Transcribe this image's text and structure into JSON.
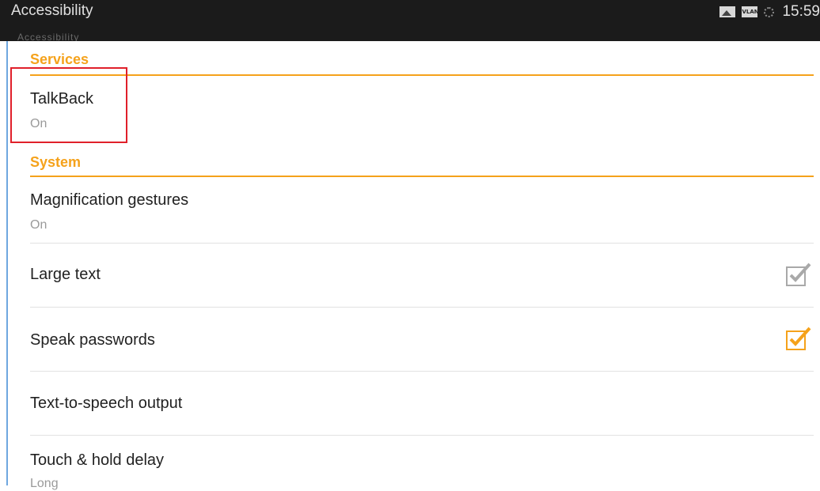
{
  "statusbar": {
    "title": "Accessibility",
    "subtitle": "Accessibility",
    "vlan_label": "VLAN",
    "time": "15:59"
  },
  "sections": {
    "services": {
      "header": "Services",
      "talkback": {
        "title": "TalkBack",
        "summary": "On"
      }
    },
    "system": {
      "header": "System",
      "magnification": {
        "title": "Magnification gestures",
        "summary": "On"
      },
      "large_text": {
        "title": "Large text",
        "checked": true,
        "enabled": false
      },
      "speak_passwords": {
        "title": "Speak passwords",
        "checked": true,
        "enabled": true
      },
      "tts": {
        "title": "Text-to-speech output"
      },
      "touch_hold": {
        "title": "Touch & hold delay",
        "summary": "Long"
      }
    }
  },
  "colors": {
    "accent": "#f5a21b",
    "checkbox_disabled": "#a9a9a9",
    "highlight_box": "#e0202a",
    "statusbar_bg": "#1b1b1b"
  }
}
